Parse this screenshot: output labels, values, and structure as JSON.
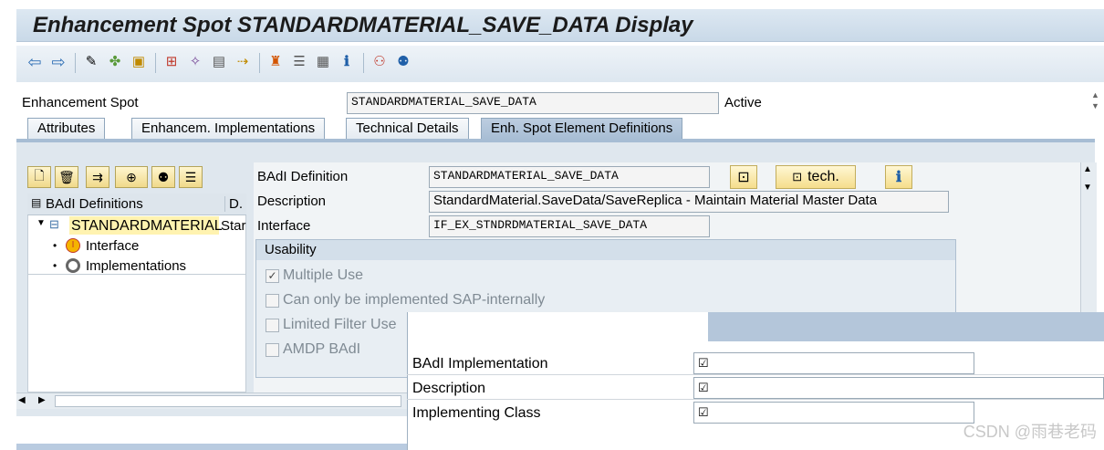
{
  "window": {
    "title": "Enhancement Spot STANDARDMATERIAL_SAVE_DATA Display"
  },
  "toolbar": {
    "icons": [
      "back-arrow-icon",
      "forward-arrow-icon",
      "display-change-icon",
      "other-object-icon",
      "activate-icon",
      "where-used-icon",
      "object-list-icon",
      "navigation-icon",
      "hierarchy-icon",
      "layout-icon",
      "frames-icon",
      "info-icon",
      "group-icon",
      "users-icon"
    ]
  },
  "header": {
    "spot_label": "Enhancement Spot",
    "spot_value": "STANDARDMATERIAL_SAVE_DATA",
    "status": "Active"
  },
  "tabs": [
    {
      "label": "Attributes",
      "active": false
    },
    {
      "label": "Enhancem. Implementations",
      "active": false
    },
    {
      "label": "Technical Details",
      "active": false
    },
    {
      "label": "Enh. Spot Element Definitions",
      "active": true
    }
  ],
  "tree": {
    "col1": "BAdI Definitions",
    "col2": "D.",
    "root": "STANDARDMATERIAL",
    "root_desc": "Star",
    "children": [
      "Interface",
      "Implementations"
    ]
  },
  "details": {
    "badi_def_label": "BAdI Definition",
    "badi_def_value": "STANDARDMATERIAL_SAVE_DATA",
    "desc_label": "Description",
    "desc_value": "StandardMaterial.SaveData/SaveReplica - Maintain Material Master Data",
    "interface_label": "Interface",
    "interface_value": "IF_EX_STNDRDMATERIAL_SAVE_DATA",
    "tech_button": "tech."
  },
  "usability": {
    "title": "Usability",
    "options": [
      {
        "label": "Multiple Use",
        "checked": true
      },
      {
        "label": "Can only be implemented SAP-internally",
        "checked": false
      },
      {
        "label": "Limited Filter Use",
        "checked": false
      },
      {
        "label": "AMDP BAdI",
        "checked": false
      }
    ]
  },
  "popup": {
    "rows": [
      "BAdI Implementation",
      "Description",
      "Implementing Class"
    ]
  },
  "watermark": "CSDN @雨巷老码"
}
